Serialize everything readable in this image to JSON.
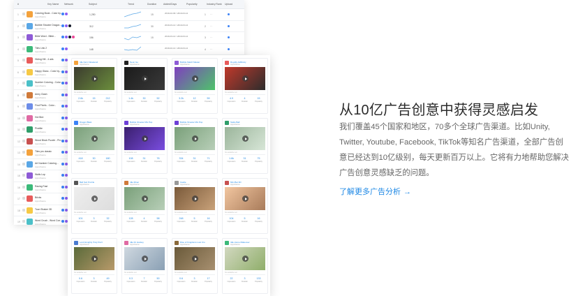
{
  "table": {
    "headers": [
      "#",
      "Key Name",
      "Network",
      "Subject",
      "Trend",
      "Duration",
      "Added/Days",
      "Popularity",
      "Industry Rank",
      "Upload"
    ],
    "rows": [
      {
        "num": "1",
        "name": "Coloring Book - Color by...",
        "sub": "Apps/Game",
        "value": "1,250",
        "duration": "15",
        "date": "2019-02-09 / 2019-03-14",
        "rank": "1"
      },
      {
        "num": "2",
        "name": "Bubble Shooter Dragon...",
        "sub": "Apps/Game",
        "value": "312",
        "duration": "30",
        "date": "2019-03-14 / 2019-03-14",
        "rank": "2"
      },
      {
        "num": "3",
        "name": "Bible Word - Bible...",
        "sub": "Apps/Game",
        "value": "156",
        "duration": "15",
        "date": "2019-03-14 / 2019-03-14",
        "rank": "3"
      },
      {
        "num": "4",
        "name": "Tiles Link 2",
        "sub": "Apps/Game",
        "value": "148",
        "duration": "",
        "date": "2019-02-14 / 2019-03-14",
        "rank": "4"
      },
      {
        "num": "5",
        "name": "Hiding Hill - 4 ads",
        "sub": "Apps/Game",
        "value": "",
        "duration": "",
        "date": "",
        "rank": "5"
      },
      {
        "num": "6",
        "name": "Happy Glass - Color by...",
        "sub": "Apps/Game",
        "value": "",
        "duration": "",
        "date": "",
        "rank": "6"
      },
      {
        "num": "7",
        "name": "Number Coloring - Color...",
        "sub": "Apps/Game",
        "value": "",
        "duration": "",
        "date": "",
        "rank": "7"
      },
      {
        "num": "8",
        "name": "Army Clash",
        "sub": "Apps/Game",
        "value": "",
        "duration": "",
        "date": "",
        "rank": "8"
      },
      {
        "num": "9",
        "name": "Find Pixels - Color...",
        "sub": "Apps/Game",
        "value": "",
        "duration": "",
        "date": "",
        "rank": "9"
      },
      {
        "num": "10",
        "name": "Hot Bird",
        "sub": "Apps/Game",
        "value": "",
        "duration": "",
        "date": "",
        "rank": "10"
      },
      {
        "num": "11",
        "name": "Pixelite",
        "sub": "Apps/Game",
        "value": "",
        "duration": "",
        "date": "",
        "rank": "11"
      },
      {
        "num": "12",
        "name": "Wood Block Puzzle - Pro",
        "sub": "Apps/Game",
        "value": "",
        "duration": "",
        "date": "",
        "rank": "12"
      },
      {
        "num": "13",
        "name": "Tiles pro classic",
        "sub": "Apps/Game",
        "value": "",
        "duration": "",
        "date": "",
        "rank": "13"
      },
      {
        "num": "14",
        "name": "Art Number Coloring...",
        "sub": "Apps/Game",
        "value": "",
        "duration": "",
        "date": "",
        "rank": "14"
      },
      {
        "num": "15",
        "name": "Walls Lop",
        "sub": "Apps/Game",
        "value": "",
        "duration": "",
        "date": "",
        "rank": "15"
      },
      {
        "num": "16",
        "name": "Racing Fast",
        "sub": "Apps/Game",
        "value": "",
        "duration": "",
        "date": "",
        "rank": "16"
      },
      {
        "num": "17",
        "name": "Bricks",
        "sub": "Apps/Game",
        "value": "",
        "duration": "",
        "date": "",
        "rank": "17"
      },
      {
        "num": "18",
        "name": "Toon Shaker 3D",
        "sub": "Apps/Game",
        "value": "",
        "duration": "",
        "date": "",
        "rank": "18"
      },
      {
        "num": "19",
        "name": "Word Crush - Word Con...",
        "sub": "Apps/Game",
        "value": "",
        "duration": "",
        "date": "",
        "rank": "19"
      },
      {
        "num": "20",
        "name": "Glasses Blade",
        "sub": "Apps/Game",
        "value": "",
        "duration": "",
        "date": "",
        "rank": "20"
      },
      {
        "num": "21",
        "name": "UnlockReveal",
        "sub": "Apps/Game",
        "value": "",
        "duration": "",
        "date": "",
        "rank": "21"
      },
      {
        "num": "22",
        "name": "Heart Jelly Story",
        "sub": "Apps/Game",
        "value": "",
        "duration": "",
        "date": "",
        "rank": "22"
      }
    ]
  },
  "cards": [
    {
      "title": "Idle Farm Weekend",
      "sub": "Apps/Game",
      "stats": [
        "2.6k",
        "15",
        "212"
      ],
      "note": "No available text"
    },
    {
      "title": "Neon Go",
      "sub": "Apps/Game",
      "stats": [
        "1.4k",
        "30",
        "52"
      ],
      "note": "No available text"
    },
    {
      "title": "Bubble Match Master",
      "sub": "Apps/Game",
      "stats": [
        "3.2k",
        "12",
        "59"
      ],
      "note": "No available text"
    },
    {
      "title": "Royalty Adlibrary",
      "sub": "Apps/Game",
      "stats": [
        "4.9",
        "4",
        "15"
      ],
      "note": "No available text"
    },
    {
      "title": "Dragon Blast",
      "sub": "Apps/Game",
      "stats": [
        "418",
        "30",
        "180"
      ],
      "note": "No available text"
    },
    {
      "title": "Bubble Shooter Mix Pop",
      "sub": "Apps/Game",
      "stats": [
        "108",
        "31",
        "76"
      ],
      "note": "No available text"
    },
    {
      "title": "Bubble Shooter Mix Pop",
      "sub": "Apps/Game",
      "stats": [
        "334",
        "31",
        "71"
      ],
      "note": "No available text"
    },
    {
      "title": "Stelle Ball",
      "sub": "Apps/Game",
      "stats": [
        "1.6k",
        "31",
        "75"
      ],
      "note": "No available text"
    },
    {
      "title": "Ball Sort Puzzle",
      "sub": "Apps/Game",
      "stats": [
        "101",
        "3",
        "32"
      ],
      "note": "No available text"
    },
    {
      "title": "Idle Miner",
      "sub": "Apps/Game",
      "stats": [
        "128",
        "4",
        "58"
      ],
      "note": "No available text"
    },
    {
      "title": "Castle",
      "sub": "Apps/Game",
      "stats": [
        "248",
        "5",
        "16"
      ],
      "note": "No available text"
    },
    {
      "title": "Mini Bet 3D",
      "sub": "Apps/Game",
      "stats": [
        "104",
        "5",
        "16"
      ],
      "note": "No available text"
    },
    {
      "title": "Lord Almighty Truly Puzz",
      "sub": "Apps/Game",
      "stats": [
        "0.6",
        "3",
        "49"
      ],
      "note": "No available text"
    },
    {
      "title": "Idle Fit Hockey",
      "sub": "Apps/Game",
      "stats": [
        "0.3",
        "7",
        "50"
      ],
      "note": "No available text"
    },
    {
      "title": "Rise of Kingdoms Lost Cru",
      "sub": "Apps/Game",
      "stats": [
        "0.6",
        "3",
        "17"
      ],
      "note": "No available text"
    },
    {
      "title": "Idle Home Makeover",
      "sub": "Apps/Game",
      "stats": [
        "22",
        "3",
        "133"
      ],
      "note": "No available text"
    }
  ],
  "card_stat_labels": [
    "Impression",
    "Duration",
    "Popularity"
  ],
  "hero": {
    "headline": "从10亿广告创意中获得灵感启发",
    "desc_lines": [
      "我们覆盖45个国家和地区，70多个全球广告渠道。比如Unity,",
      "Twitter, Youtube, Facebook, TikTok等知名广告渠道，全部广告创",
      "意已经达到10亿级别，每天更新百万以上。它将有力地帮助您解决",
      "广告创意灵感缺乏的问题。"
    ],
    "cta_label": "了解更多广告分析",
    "cta_arrow": "→"
  },
  "colors": {
    "accent": "#1e88e5",
    "headline": "#2b2b2b",
    "body": "#666666"
  }
}
